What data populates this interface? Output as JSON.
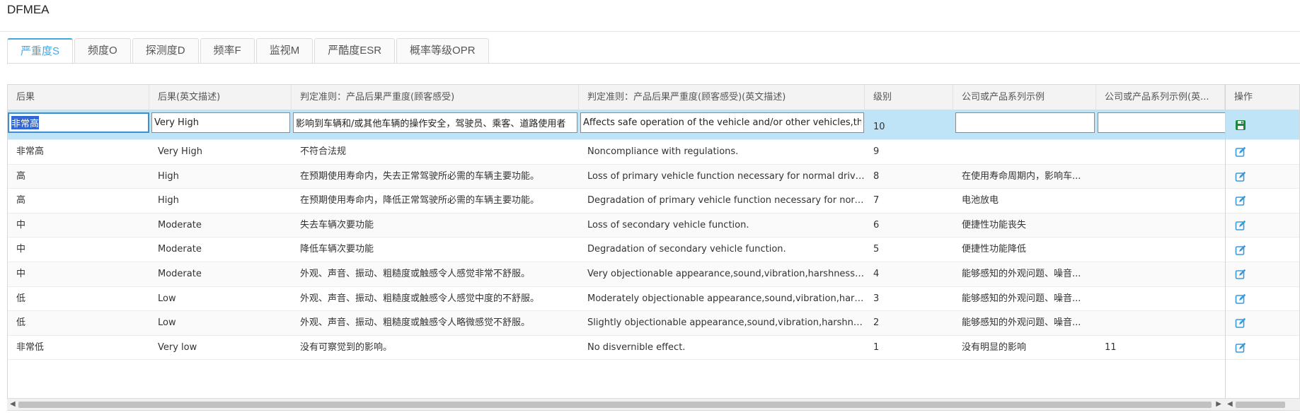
{
  "page": {
    "title": "DFMEA"
  },
  "tabs": [
    {
      "label": "严重度S",
      "active": true
    },
    {
      "label": "频度O"
    },
    {
      "label": "探测度D"
    },
    {
      "label": "频率F"
    },
    {
      "label": "监视M"
    },
    {
      "label": "严酷度ESR"
    },
    {
      "label": "概率等级OPR"
    }
  ],
  "table": {
    "columns": [
      "后果",
      "后果(英文描述)",
      "判定准则：产品后果严重度(顾客感受)",
      "判定准则：产品后果严重度(顾客感受)(英文描述)",
      "级别",
      "公司或产品系列示例",
      "公司或产品系列示例(英...",
      "操作"
    ],
    "edit_row": {
      "consequence": "非常高",
      "consequence_en": "Very High",
      "criteria": "影响到车辆和/或其他车辆的操作安全，驾驶员、乘客、道路使用者",
      "criteria_en": "Affects safe operation of the vehicle and/or other vehicles,the healt",
      "level": "10",
      "example": "",
      "example_en": ""
    },
    "rows": [
      {
        "c0": "非常高",
        "c1": "Very High",
        "c2": "不符合法规",
        "c3": "Noncompliance with regulations.",
        "c4": "9",
        "c5": "",
        "c6": ""
      },
      {
        "c0": "高",
        "c1": "High",
        "c2": "在预期使用寿命内，失去正常驾驶所必需的车辆主要功能。",
        "c3": "Loss of primary vehicle function necessary for normal driving ...",
        "c4": "8",
        "c5": "在使用寿命周期内，影响车...",
        "c6": ""
      },
      {
        "c0": "高",
        "c1": "High",
        "c2": "在预期使用寿命内，降低正常驾驶所必需的车辆主要功能。",
        "c3": "Degradation of primary vehicle function necessary for normal...",
        "c4": "7",
        "c5": "电池放电",
        "c6": ""
      },
      {
        "c0": "中",
        "c1": "Moderate",
        "c2": "失去车辆次要功能",
        "c3": "Loss of secondary vehicle function.",
        "c4": "6",
        "c5": "便捷性功能丧失",
        "c6": ""
      },
      {
        "c0": "中",
        "c1": "Moderate",
        "c2": "降低车辆次要功能",
        "c3": "Degradation of secondary vehicle function.",
        "c4": "5",
        "c5": "便捷性功能降低",
        "c6": ""
      },
      {
        "c0": "中",
        "c1": "Moderate",
        "c2": "外观、声音、振动、粗糙度或触感令人感觉非常不舒服。",
        "c3": "Very objectionable appearance,sound,vibration,harshness,or h...",
        "c4": "4",
        "c5": "能够感知的外观问题、噪音...",
        "c6": ""
      },
      {
        "c0": "低",
        "c1": "Low",
        "c2": "外观、声音、振动、粗糙度或触感令人感觉中度的不舒服。",
        "c3": "Moderately objectionable appearance,sound,vibration,harshn...",
        "c4": "3",
        "c5": "能够感知的外观问题、噪音...",
        "c6": ""
      },
      {
        "c0": "低",
        "c1": "Low",
        "c2": "外观、声音、振动、粗糙度或触感令人略微感觉不舒服。",
        "c3": "Slightly objectionable appearance,sound,vibration,harshness....",
        "c4": "2",
        "c5": "能够感知的外观问题、噪音...",
        "c6": ""
      },
      {
        "c0": "非常低",
        "c1": "Very low",
        "c2": "没有可察觉到的影响。",
        "c3": "No disvernible effect.",
        "c4": "1",
        "c5": "没有明显的影响",
        "c6": "11"
      }
    ]
  },
  "colors": {
    "accent": "#3fa9e6",
    "edit_row_bg": "#bfe3f7",
    "save_icon": "#1a8a3a",
    "edit_icon": "#3a9ad9"
  },
  "icons": {
    "save": "save-icon",
    "edit": "edit-icon"
  }
}
